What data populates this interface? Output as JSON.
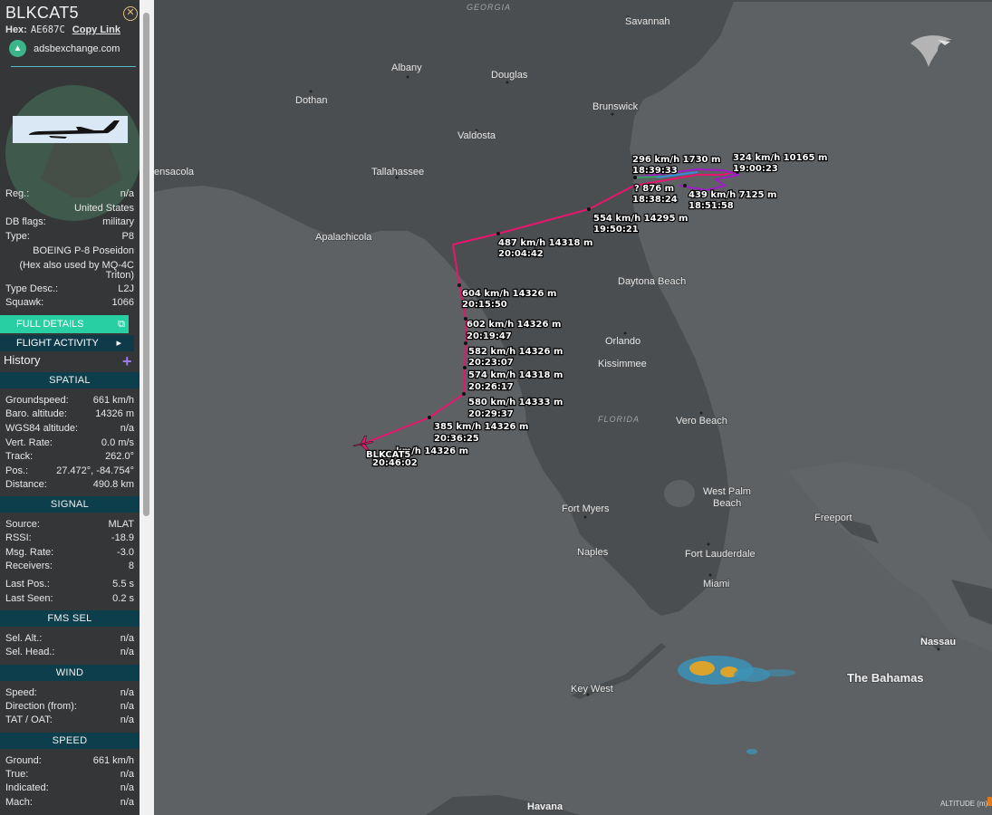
{
  "aircraft": {
    "callsign": "BLKCAT5",
    "hex_label": "Hex:",
    "hex": "AE687C",
    "copy_link": "Copy Link",
    "source_site": "adsbexchange.com"
  },
  "info": {
    "reg_label": "Reg.:",
    "reg": "n/a",
    "country": "United States",
    "dbflags_label": "DB flags:",
    "dbflags": "military",
    "type_label": "Type:",
    "type": "P8",
    "type_name": "BOEING P-8 Poseidon",
    "type_note_1": "(Hex also used by MQ-4C",
    "type_note_2": "Triton)",
    "typedesc_label": "Type Desc.:",
    "typedesc": "L2J",
    "squawk_label": "Squawk:",
    "squawk": "1066"
  },
  "buttons": {
    "full_details": "FULL DETAILS",
    "flight_activity": "FLIGHT ACTIVITY",
    "history": "History"
  },
  "spatial": {
    "header": "SPATIAL",
    "rows": [
      {
        "k": "Groundspeed:",
        "v": "661 km/h"
      },
      {
        "k": "Baro. altitude:",
        "v": "14326 m"
      },
      {
        "k": "WGS84 altitude:",
        "v": "n/a"
      },
      {
        "k": "Vert. Rate:",
        "v": "0.0 m/s"
      },
      {
        "k": "Track:",
        "v": "262.0°"
      },
      {
        "k": "Pos.:",
        "v": "27.472°, -84.754°"
      },
      {
        "k": "Distance:",
        "v": "490.8 km"
      }
    ]
  },
  "signal": {
    "header": "SIGNAL",
    "rows": [
      {
        "k": "Source:",
        "v": "MLAT"
      },
      {
        "k": "RSSI:",
        "v": "-18.9"
      },
      {
        "k": "Msg. Rate:",
        "v": "-3.0"
      },
      {
        "k": "Receivers:",
        "v": "8"
      },
      {
        "k": "Last Pos.:",
        "v": "5.5 s"
      },
      {
        "k": "Last Seen:",
        "v": "0.2 s"
      }
    ]
  },
  "fms": {
    "header": "FMS SEL",
    "rows": [
      {
        "k": "Sel. Alt.:",
        "v": "n/a"
      },
      {
        "k": "Sel. Head.:",
        "v": "n/a"
      }
    ]
  },
  "wind": {
    "header": "WIND",
    "rows": [
      {
        "k": "Speed:",
        "v": "n/a"
      },
      {
        "k": "Direction (from):",
        "v": "n/a"
      },
      {
        "k": "TAT / OAT:",
        "v": "n/a"
      }
    ]
  },
  "speed": {
    "header": "SPEED",
    "rows": [
      {
        "k": "Ground:",
        "v": "661 km/h"
      },
      {
        "k": "True:",
        "v": "n/a"
      },
      {
        "k": "Indicated:",
        "v": "n/a"
      },
      {
        "k": "Mach:",
        "v": "n/a"
      }
    ]
  },
  "map": {
    "regions": {
      "georgia": "GEORGIA",
      "florida": "FLORIDA"
    },
    "cities": {
      "savannah": "Savannah",
      "albany": "Albany",
      "douglas": "Douglas",
      "dothan": "Dothan",
      "brunswick": "Brunswick",
      "valdosta": "Valdosta",
      "pensacola": "ensacola",
      "tallahassee": "Tallahassee",
      "apalachicola": "Apalachicola",
      "daytona": "Daytona Beach",
      "orlando": "Orlando",
      "kissimmee": "Kissimmee",
      "vero": "Vero Beach",
      "wpb1": "West Palm",
      "wpb2": "Beach",
      "fortmyers": "Fort Myers",
      "naples": "Naples",
      "ftlaud": "Fort Lauderdale",
      "miami": "Miami",
      "keywest": "Key West",
      "freeport": "Freeport",
      "nassau": "Nassau",
      "bahamas": "The Bahamas",
      "havana": "Havana"
    },
    "track_labels": [
      {
        "l1": "296 km/h  1730 m",
        "l2": "18:39:33"
      },
      {
        "l1": "324 km/h  10165 m",
        "l2": "19:00:23"
      },
      {
        "l1": "?   876 m",
        "l2": "18:38:24"
      },
      {
        "l1": "439 km/h  7125 m",
        "l2": "18:51:58"
      },
      {
        "l1": "554 km/h  14295 m",
        "l2": "19:50:21"
      },
      {
        "l1": "487 km/h  14318 m",
        "l2": "20:04:42"
      },
      {
        "l1": "604 km/h  14326 m",
        "l2": "20:15:50"
      },
      {
        "l1": "602 km/h  14326 m",
        "l2": "20:19:47"
      },
      {
        "l1": "582 km/h  14326 m",
        "l2": "20:23:07"
      },
      {
        "l1": "574 km/h  14318 m",
        "l2": "20:26:17"
      },
      {
        "l1": "580 km/h  14333 m",
        "l2": "20:29:37"
      },
      {
        "l1": "385 km/h  14326 m",
        "l2": "20:36:25"
      },
      {
        "l1": "km/h  14326 m",
        "l2": "20:46:02"
      }
    ],
    "plane_label": "BLKCAT5",
    "altitude_legend": "ALTITUDE (m)",
    "colors": {
      "track": "#e8156f",
      "track_low": "#a21cc8"
    }
  }
}
